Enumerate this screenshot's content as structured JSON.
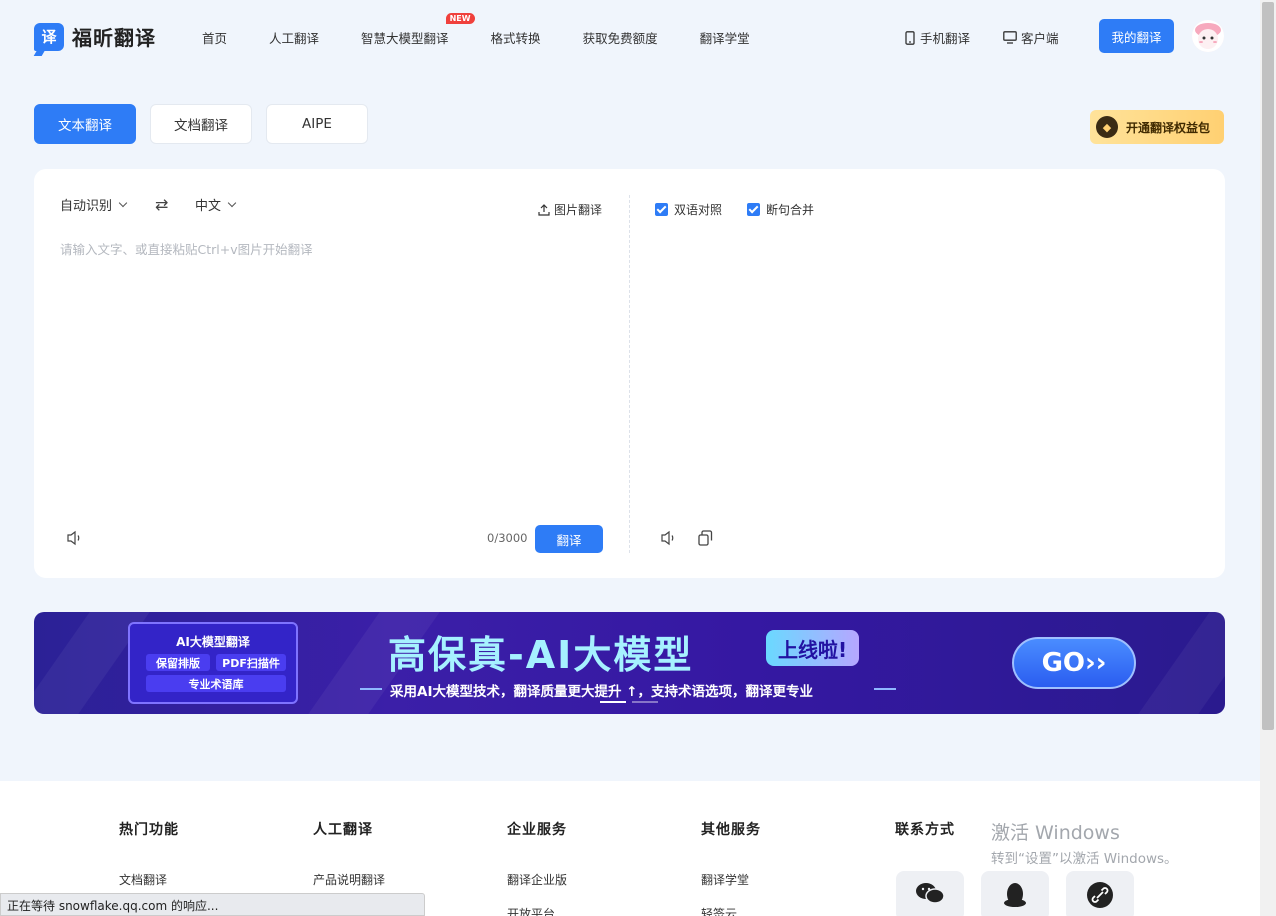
{
  "header": {
    "logo_mark": "译",
    "logo_text": "福昕翻译",
    "nav": [
      {
        "label": "首页"
      },
      {
        "label": "人工翻译"
      },
      {
        "label": "智慧大模型翻译",
        "badge": "NEW"
      },
      {
        "label": "格式转换"
      },
      {
        "label": "获取免费额度"
      },
      {
        "label": "翻译学堂"
      }
    ],
    "mobile": "手机翻译",
    "client": "客户端",
    "my_btn": "我的翻译"
  },
  "tabs": [
    "文本翻译",
    "文档翻译",
    "AIPE"
  ],
  "vip": "开通翻译权益包",
  "panel": {
    "source_lang": "自动识别",
    "target_lang": "中文",
    "image_translate": "图片翻译",
    "placeholder": "请输入文字、或直接粘贴Ctrl+v图片开始翻译",
    "counter": "0/3000",
    "translate_btn": "翻译",
    "bilingual": "双语对照",
    "merge": "断句合并"
  },
  "banner": {
    "chip_title": "AI大模型翻译",
    "chip_a": "保留排版",
    "chip_b": "PDF扫描件",
    "chip_c": "专业术语库",
    "title": "高保真-AI大模型",
    "badge": "上线啦!",
    "subtitle": "采用AI大模型技术，翻译质量更大提升 ↑，支持术语选项，翻译更专业",
    "go": "GO››"
  },
  "footer": {
    "cols": [
      {
        "title": "热门功能",
        "item": "文档翻译"
      },
      {
        "title": "人工翻译",
        "item": "产品说明翻译"
      },
      {
        "title": "企业服务",
        "item": "翻译企业版",
        "item2": "开放平台"
      },
      {
        "title": "其他服务",
        "item": "翻译学堂",
        "item2": "轻签云"
      },
      {
        "title": "联系方式"
      }
    ]
  },
  "watermark": {
    "line1": "激活 Windows",
    "line2": "转到“设置”以激活 Windows。"
  },
  "status": "正在等待 snowflake.qq.com 的响应..."
}
